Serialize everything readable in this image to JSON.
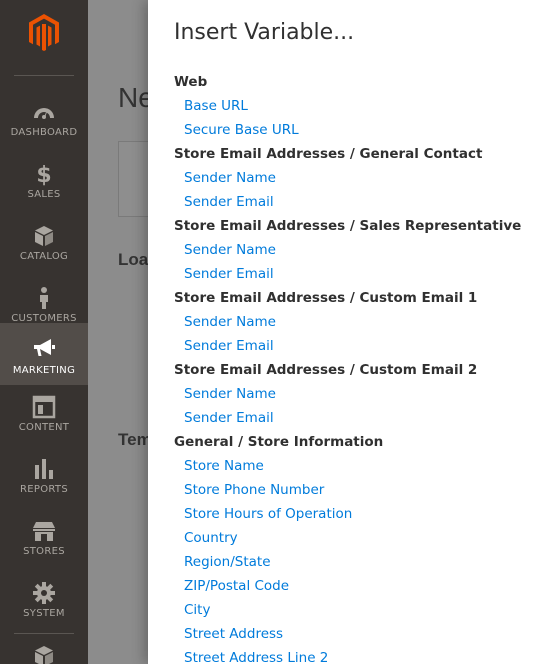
{
  "sidebar": {
    "logo": "magento-logo",
    "items": [
      {
        "label": "DASHBOARD",
        "icon": "dashboard-icon"
      },
      {
        "label": "SALES",
        "icon": "dollar-icon"
      },
      {
        "label": "CATALOG",
        "icon": "box-icon"
      },
      {
        "label": "CUSTOMERS",
        "icon": "person-icon"
      },
      {
        "label": "MARKETING",
        "icon": "megaphone-icon",
        "active": true
      },
      {
        "label": "CONTENT",
        "icon": "content-layout-icon"
      },
      {
        "label": "REPORTS",
        "icon": "bar-chart-icon"
      },
      {
        "label": "STORES",
        "icon": "storefront-icon"
      },
      {
        "label": "SYSTEM",
        "icon": "gear-icon"
      }
    ]
  },
  "background_page": {
    "title_fragment": "Ne",
    "section_load": "Loa",
    "section_tem": "Tem"
  },
  "modal": {
    "title": "Insert Variable...",
    "groups": [
      {
        "title": "Web",
        "items": [
          "Base URL",
          "Secure Base URL"
        ]
      },
      {
        "title": "Store Email Addresses / General Contact",
        "items": [
          "Sender Name",
          "Sender Email"
        ]
      },
      {
        "title": "Store Email Addresses / Sales Representative",
        "items": [
          "Sender Name",
          "Sender Email"
        ]
      },
      {
        "title": "Store Email Addresses / Custom Email 1",
        "items": [
          "Sender Name",
          "Sender Email"
        ]
      },
      {
        "title": "Store Email Addresses / Custom Email 2",
        "items": [
          "Sender Name",
          "Sender Email"
        ]
      },
      {
        "title": "General / Store Information",
        "items": [
          "Store Name",
          "Store Phone Number",
          "Store Hours of Operation",
          "Country",
          "Region/State",
          "ZIP/Postal Code",
          "City",
          "Street Address",
          "Street Address Line 2"
        ]
      }
    ]
  },
  "colors": {
    "sidebar_bg": "#373330",
    "sidebar_active_bg": "#524d49",
    "brand_orange": "#eb5202",
    "link": "#007bdb",
    "overlay": "#8c8c8c"
  }
}
